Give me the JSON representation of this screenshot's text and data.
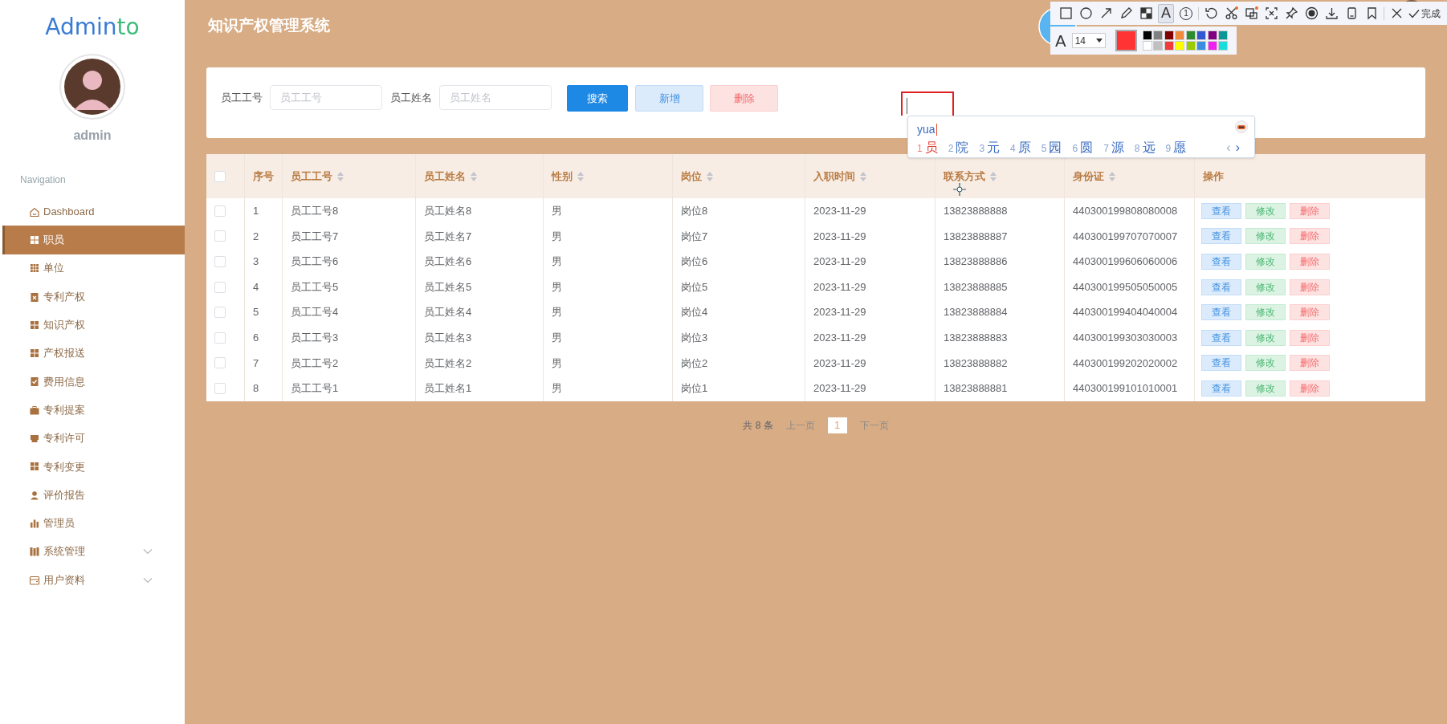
{
  "sidebar": {
    "logo": {
      "text": "Admin",
      "accent": "to"
    },
    "user": "admin",
    "section": "Navigation",
    "items": [
      {
        "label": "Dashboard",
        "kind": "link",
        "selected": false
      },
      {
        "label": "职员",
        "kind": "link",
        "selected": true
      },
      {
        "label": "单位",
        "kind": "link",
        "selected": false
      },
      {
        "label": "专利产权",
        "kind": "link",
        "selected": false
      },
      {
        "label": "知识产权",
        "kind": "link",
        "selected": false
      },
      {
        "label": "产权报送",
        "kind": "link",
        "selected": false
      },
      {
        "label": "费用信息",
        "kind": "link",
        "selected": false
      },
      {
        "label": "专利提案",
        "kind": "link",
        "selected": false
      },
      {
        "label": "专利许可",
        "kind": "link",
        "selected": false
      },
      {
        "label": "专利变更",
        "kind": "link",
        "selected": false
      },
      {
        "label": "评价报告",
        "kind": "link",
        "selected": false
      },
      {
        "label": "管理员",
        "kind": "link",
        "selected": false
      },
      {
        "label": "系统管理",
        "kind": "submenu",
        "selected": false
      },
      {
        "label": "用户资料",
        "kind": "submenu",
        "selected": false
      }
    ]
  },
  "header": {
    "title": "知识产权管理系统"
  },
  "search": {
    "fields": [
      {
        "label": "员工工号",
        "placeholder": "员工工号"
      },
      {
        "label": "员工姓名",
        "placeholder": "员工姓名"
      }
    ],
    "buttons": [
      {
        "label": "搜索",
        "kind": "primary"
      },
      {
        "label": "新增",
        "kind": "info"
      },
      {
        "label": "删除",
        "kind": "danger"
      }
    ]
  },
  "table": {
    "select_all": {
      "checked": false
    },
    "columns": [
      {
        "label": "序号",
        "sortable": false
      },
      {
        "label": "员工工号",
        "sortable": true
      },
      {
        "label": "员工姓名",
        "sortable": true
      },
      {
        "label": "性别",
        "sortable": true
      },
      {
        "label": "岗位",
        "sortable": true
      },
      {
        "label": "入职时间",
        "sortable": true
      },
      {
        "label": "联系方式",
        "sortable": true
      },
      {
        "label": "身份证",
        "sortable": true
      },
      {
        "label": "操作",
        "sortable": false
      }
    ],
    "rows": [
      {
        "checked": false,
        "cells": [
          "1",
          "员工工号8",
          "员工姓名8",
          "男",
          "岗位8",
          "2023-11-29",
          "13823888888",
          "440300199808080008"
        ],
        "actions": [
          {
            "label": "查看",
            "kind": "view"
          },
          {
            "label": "修改",
            "kind": "edit"
          },
          {
            "label": "删除",
            "kind": "delete"
          }
        ]
      },
      {
        "checked": false,
        "cells": [
          "2",
          "员工工号7",
          "员工姓名7",
          "男",
          "岗位7",
          "2023-11-29",
          "13823888887",
          "440300199707070007"
        ],
        "actions": [
          {
            "label": "查看",
            "kind": "view"
          },
          {
            "label": "修改",
            "kind": "edit"
          },
          {
            "label": "删除",
            "kind": "delete"
          }
        ]
      },
      {
        "checked": false,
        "cells": [
          "3",
          "员工工号6",
          "员工姓名6",
          "男",
          "岗位6",
          "2023-11-29",
          "13823888886",
          "440300199606060006"
        ],
        "actions": [
          {
            "label": "查看",
            "kind": "view"
          },
          {
            "label": "修改",
            "kind": "edit"
          },
          {
            "label": "删除",
            "kind": "delete"
          }
        ]
      },
      {
        "checked": false,
        "cells": [
          "4",
          "员工工号5",
          "员工姓名5",
          "男",
          "岗位5",
          "2023-11-29",
          "13823888885",
          "440300199505050005"
        ],
        "actions": [
          {
            "label": "查看",
            "kind": "view"
          },
          {
            "label": "修改",
            "kind": "edit"
          },
          {
            "label": "删除",
            "kind": "delete"
          }
        ]
      },
      {
        "checked": false,
        "cells": [
          "5",
          "员工工号4",
          "员工姓名4",
          "男",
          "岗位4",
          "2023-11-29",
          "13823888884",
          "440300199404040004"
        ],
        "actions": [
          {
            "label": "查看",
            "kind": "view"
          },
          {
            "label": "修改",
            "kind": "edit"
          },
          {
            "label": "删除",
            "kind": "delete"
          }
        ]
      },
      {
        "checked": false,
        "cells": [
          "6",
          "员工工号3",
          "员工姓名3",
          "男",
          "岗位3",
          "2023-11-29",
          "13823888883",
          "440300199303030003"
        ],
        "actions": [
          {
            "label": "查看",
            "kind": "view"
          },
          {
            "label": "修改",
            "kind": "edit"
          },
          {
            "label": "删除",
            "kind": "delete"
          }
        ]
      },
      {
        "checked": false,
        "cells": [
          "7",
          "员工工号2",
          "员工姓名2",
          "男",
          "岗位2",
          "2023-11-29",
          "13823888882",
          "440300199202020002"
        ],
        "actions": [
          {
            "label": "查看",
            "kind": "view"
          },
          {
            "label": "修改",
            "kind": "edit"
          },
          {
            "label": "删除",
            "kind": "delete"
          }
        ]
      },
      {
        "checked": false,
        "cells": [
          "8",
          "员工工号1",
          "员工姓名1",
          "男",
          "岗位1",
          "2023-11-29",
          "13823888881",
          "440300199101010001"
        ],
        "actions": [
          {
            "label": "查看",
            "kind": "view"
          },
          {
            "label": "修改",
            "kind": "edit"
          },
          {
            "label": "删除",
            "kind": "delete"
          }
        ]
      }
    ]
  },
  "pagination": {
    "total": "共 8 条",
    "prev": "上一页",
    "pages": [
      {
        "label": "1",
        "selected": true
      }
    ],
    "next": "下一页"
  },
  "capture_toolbar": {
    "tools": [
      {
        "kind": "rectangle",
        "selected": false
      },
      {
        "kind": "ellipse",
        "selected": false
      },
      {
        "kind": "arrow",
        "selected": false
      },
      {
        "kind": "pencil",
        "selected": false
      },
      {
        "kind": "mosaic",
        "selected": false
      },
      {
        "kind": "text",
        "label": "A",
        "selected": true
      },
      {
        "kind": "number",
        "label": "1",
        "selected": false
      },
      {
        "kind": "undo",
        "selected": false
      },
      {
        "kind": "scissors",
        "selected": false
      },
      {
        "kind": "ocr",
        "selected": false
      },
      {
        "kind": "capture",
        "selected": false
      },
      {
        "kind": "pin",
        "selected": false
      },
      {
        "kind": "record",
        "selected": false
      },
      {
        "kind": "download",
        "selected": false
      },
      {
        "kind": "phone",
        "selected": false
      },
      {
        "kind": "bookmark",
        "selected": false
      },
      {
        "kind": "close",
        "selected": false
      }
    ],
    "done": "完成",
    "font_label": "A",
    "font_size": "14",
    "current": {
      "color": "#ff3333"
    },
    "palette": [
      {
        "color": "#000000"
      },
      {
        "color": "#808080"
      },
      {
        "color": "#800000"
      },
      {
        "color": "#f28a3c"
      },
      {
        "color": "#2e8b2e"
      },
      {
        "color": "#3358d4"
      },
      {
        "color": "#800080"
      },
      {
        "color": "#0a9696"
      },
      {
        "color": "#ffffff"
      },
      {
        "color": "#c0c0c0"
      },
      {
        "color": "#f23c3c"
      },
      {
        "color": "#ffff00"
      },
      {
        "color": "#99cc00"
      },
      {
        "color": "#3a8ee0"
      },
      {
        "color": "#f020f0"
      },
      {
        "color": "#1adcdc"
      }
    ]
  },
  "ime": {
    "composition": "yua",
    "candidates": [
      {
        "number": "1",
        "text": "员",
        "selected": true
      },
      {
        "number": "2",
        "text": "院",
        "selected": false
      },
      {
        "number": "3",
        "text": "元",
        "selected": false
      },
      {
        "number": "4",
        "text": "原",
        "selected": false
      },
      {
        "number": "5",
        "text": "园",
        "selected": false
      },
      {
        "number": "6",
        "text": "圆",
        "selected": false
      },
      {
        "number": "7",
        "text": "源",
        "selected": false
      },
      {
        "number": "8",
        "text": "远",
        "selected": false
      },
      {
        "number": "9",
        "text": "愿",
        "selected": false
      }
    ],
    "prev": "‹",
    "next": "›"
  }
}
